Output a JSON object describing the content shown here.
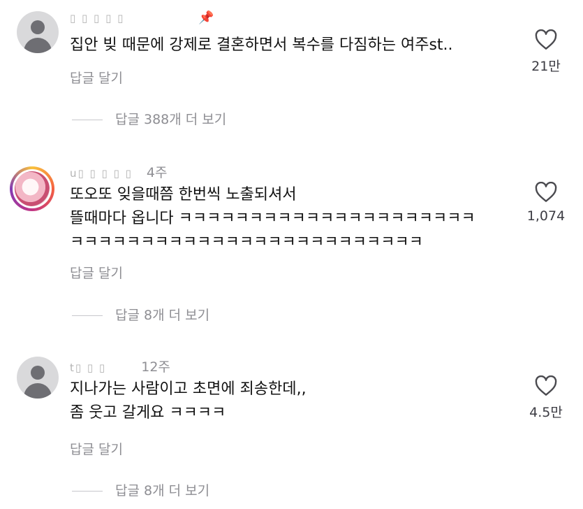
{
  "comments": [
    {
      "username": "▯ ▯ ▯ ▯ ▯",
      "time": "",
      "pinned": true,
      "pin_icon": "pin-icon",
      "lines": [
        "집안 빚 때문에 강제로 결혼하면서 복수를 다짐하는 여주st.."
      ],
      "reply_label": "답글 달기",
      "view_replies_label": "답글 388개 더 보기",
      "like_count": "21만",
      "like_icon": "heart-outline-icon"
    },
    {
      "username": "u▯ ▯ ▯ ▯ ▯",
      "time": "4주",
      "pinned": false,
      "lines": [
        "또오또 잊을때쯤 한번씩 노출되셔서",
        "뜰때마다 옵니다 ㅋㅋㅋㅋㅋㅋㅋㅋㅋㅋㅋㅋㅋㅋㅋㅋㅋㅋㅋㅋㅋ",
        "ㅋㅋㅋㅋㅋㅋㅋㅋㅋㅋㅋㅋㅋㅋㅋㅋㅋㅋㅋㅋㅋㅋㅋㅋㅋ"
      ],
      "reply_label": "답글 달기",
      "view_replies_label": "답글 8개 더 보기",
      "like_count": "1,074",
      "like_icon": "heart-outline-icon"
    },
    {
      "username": "t▯ ▯ ▯",
      "time": "12주",
      "pinned": false,
      "lines": [
        "지나가는 사람이고 초면에 죄송한데,,",
        "좀 웃고 갈게요 ㅋㅋㅋㅋ"
      ],
      "reply_label": "답글 달기",
      "view_replies_label": "답글 8개 더 보기",
      "like_count": "4.5만",
      "like_icon": "heart-outline-icon"
    }
  ],
  "colors": {
    "secondary_text": "#8e8e93",
    "primary_text": "#111111",
    "story_ring": [
      "#f9c23c",
      "#f56040",
      "#c13584",
      "#833ab4"
    ]
  }
}
